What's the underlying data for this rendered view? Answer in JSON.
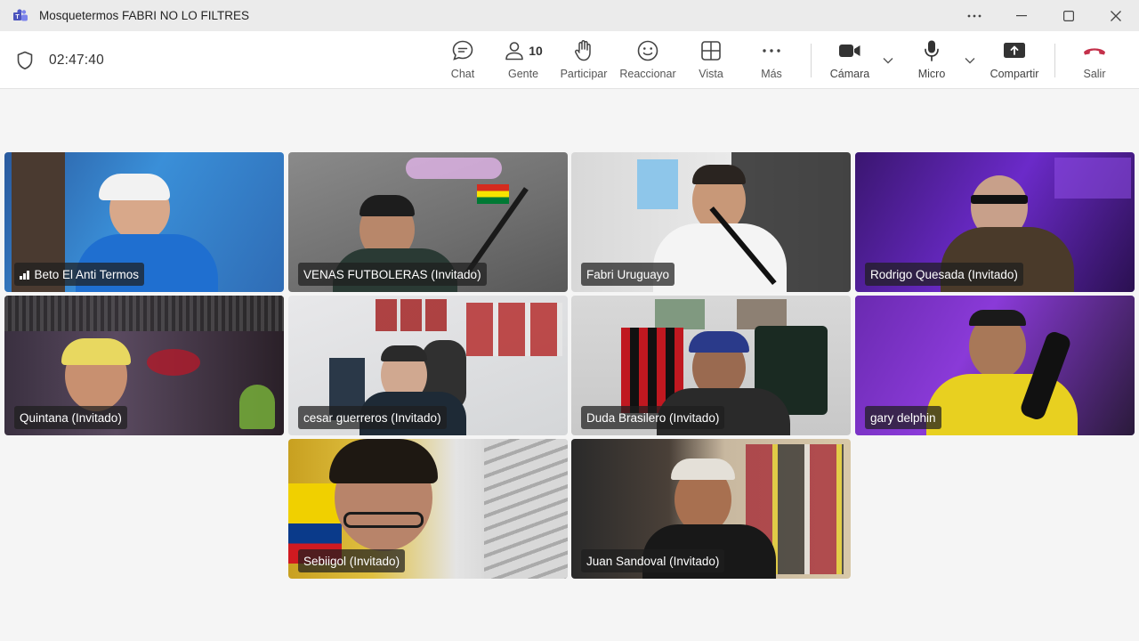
{
  "window": {
    "title": "Mosquetermos FABRI NO LO FILTRES",
    "controls": [
      "more-icon",
      "minimize-icon",
      "maximize-icon",
      "close-icon"
    ]
  },
  "toolbar": {
    "timer": "02:47:40",
    "chat_label": "Chat",
    "people_label": "Gente",
    "people_count": "10",
    "raise_label": "Participar",
    "react_label": "Reaccionar",
    "view_label": "Vista",
    "more_label": "Más",
    "camera_label": "Cámara",
    "mic_label": "Micro",
    "share_label": "Compartir",
    "leave_label": "Salir"
  },
  "colors": {
    "leave": "#c4314b",
    "active_outline": "#8b8fe0",
    "chip_bg": "#1e1e1e"
  },
  "participants": [
    {
      "name": "Beto El Anti Termos"
    },
    {
      "name": "VENAS FUTBOLERAS (Invitado)"
    },
    {
      "name": "Fabri Uruguayo"
    },
    {
      "name": "Rodrigo Quesada (Invitado)"
    },
    {
      "name": "Quintana (Invitado)"
    },
    {
      "name": "cesar guerreros (Invitado)"
    },
    {
      "name": "Duda Brasilero (Invitado)"
    },
    {
      "name": "gary delphin"
    },
    {
      "name": "Sebiigol (Invitado)"
    },
    {
      "name": "Juan Sandoval (Invitado)"
    }
  ]
}
